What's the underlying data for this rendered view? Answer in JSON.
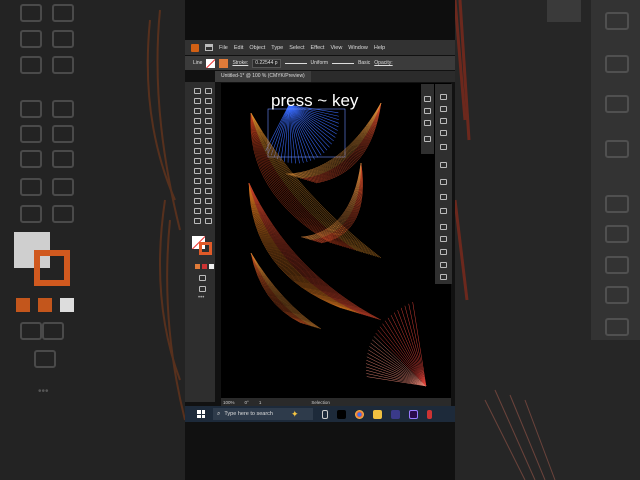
{
  "overlay_text": "press ~ key",
  "menu": [
    "File",
    "Edit",
    "Object",
    "Type",
    "Select",
    "Effect",
    "View",
    "Window",
    "Help"
  ],
  "control": {
    "selection_label": "Line",
    "stroke_label": "Stroke:",
    "stroke_value": "0.22544 p",
    "profile_label": "Uniform",
    "brush_label": "Basic",
    "opacity_label": "Opacity:"
  },
  "document_tab": "Untitled-1* @ 100 % (CMYK/Preview)",
  "status": {
    "zoom": "100%",
    "rotation": "0°",
    "artboard": "1",
    "mode": "Selection"
  },
  "taskbar": {
    "search_placeholder": "Type here to search"
  },
  "colors": {
    "accent_orange": "#e07b39",
    "selection_blue": "#3a6cff",
    "fan_red": "#e0433a",
    "taskbar": "#1d2a3a"
  },
  "icons": [
    "illustrator-logo",
    "home-icon",
    "windows-start-icon",
    "search-icon",
    "copilot-icon",
    "task-view-icon",
    "chrome-icon",
    "file-explorer-icon",
    "premiere-icon"
  ]
}
